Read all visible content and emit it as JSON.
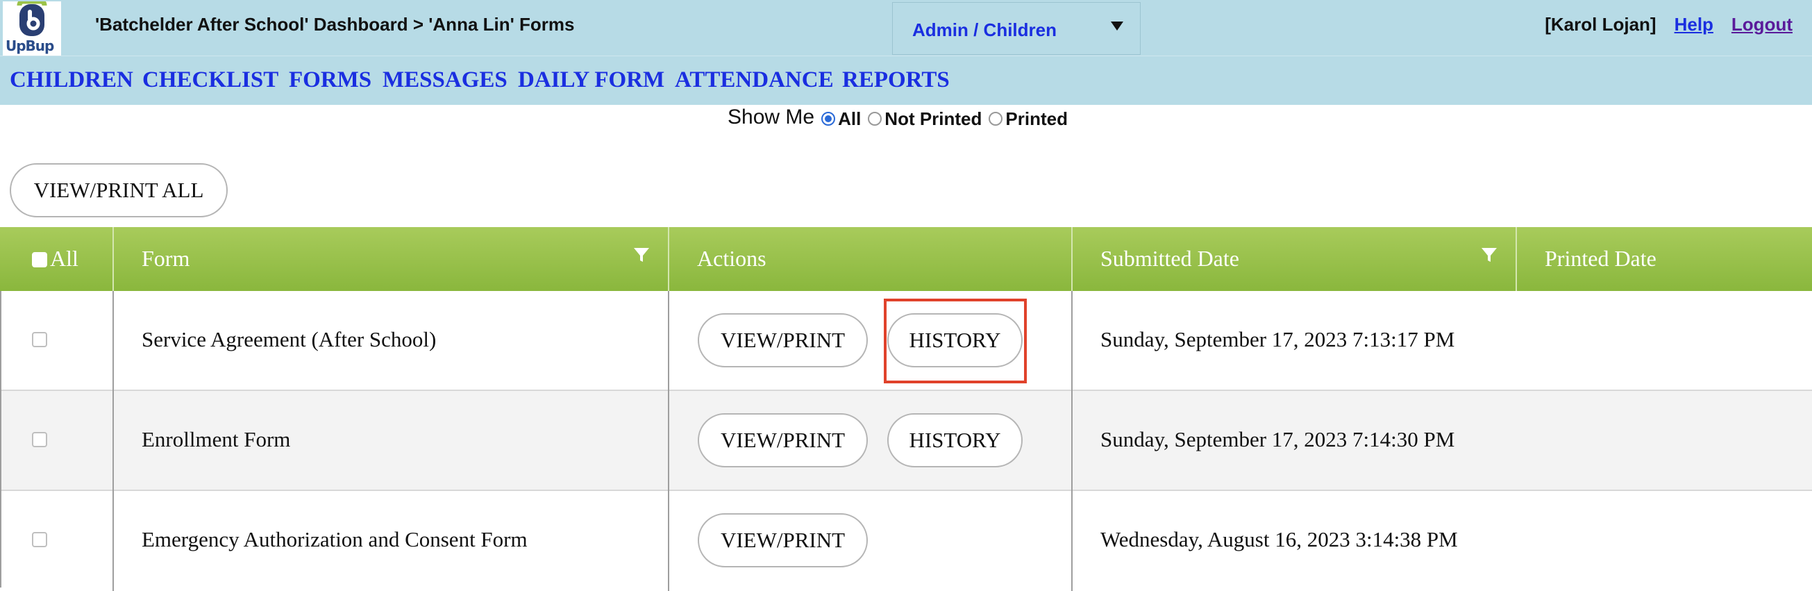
{
  "header": {
    "logo_text": "UpBup",
    "breadcrumb": "'Batchelder After School' Dashboard > 'Anna Lin' Forms",
    "role_select": "Admin / Children",
    "user_name": "[Karol Lojan]",
    "help_label": "Help",
    "logout_label": "Logout"
  },
  "nav": {
    "items": [
      "CHILDREN",
      "CHECKLIST",
      "FORMS",
      "MESSAGES",
      "DAILY FORM",
      "ATTENDANCE",
      "REPORTS"
    ]
  },
  "filter": {
    "label": "Show Me",
    "options": [
      "All",
      "Not Printed",
      "Printed"
    ],
    "selected": "All"
  },
  "toolbar": {
    "view_print_all": "VIEW/PRINT ALL"
  },
  "table": {
    "header_color": "#9bc24a",
    "columns": [
      "All",
      "Form",
      "Actions",
      "Submitted Date",
      "Printed Date"
    ],
    "view_print_label": "VIEW/PRINT",
    "history_label": "HISTORY",
    "rows": [
      {
        "form": "Service Agreement (After School)",
        "submitted": "Sunday, September 17, 2023 7:13:17 PM",
        "printed": "",
        "has_history": true
      },
      {
        "form": "Enrollment Form",
        "submitted": "Sunday, September 17, 2023 7:14:30 PM",
        "printed": "",
        "has_history": true
      },
      {
        "form": "Emergency Authorization and Consent Form",
        "submitted": "Wednesday, August 16, 2023 3:14:38 PM",
        "printed": "",
        "has_history": false
      }
    ]
  }
}
